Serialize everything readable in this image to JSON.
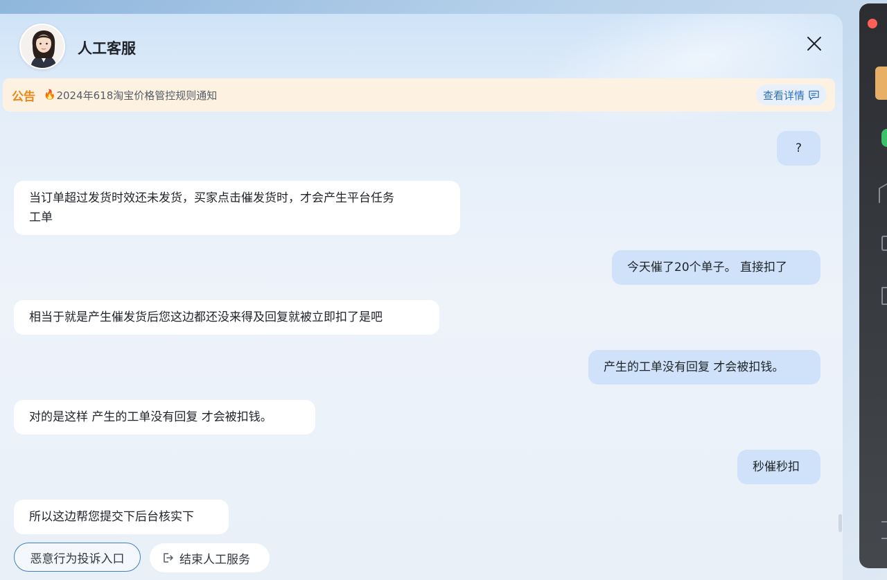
{
  "header": {
    "title": "人工客服"
  },
  "notice": {
    "label": "公告",
    "fire_icon": "🔥",
    "text": "2024年618淘宝价格管控规则通知",
    "detail_label": "查看详情"
  },
  "messages": [
    {
      "role": "user",
      "text": "?"
    },
    {
      "role": "agent",
      "line1": "当订单超过发货时效还未发货，买家点击催发货时，才会产生平台任务",
      "line2": "工单"
    },
    {
      "role": "user",
      "text": "今天催了20个单子。 直接扣了"
    },
    {
      "role": "agent",
      "text": "相当于就是产生催发货后您这边都还没来得及回复就被立即扣了是吧"
    },
    {
      "role": "user",
      "text": "产生的工单没有回复 才会被扣钱。"
    },
    {
      "role": "agent",
      "text": "对的是这样 产生的工单没有回复 才会被扣钱。"
    },
    {
      "role": "user",
      "text": "秒催秒扣"
    },
    {
      "role": "agent",
      "text": "所以这边帮您提交下后台核实下"
    }
  ],
  "quick_actions": {
    "complaint": "恶意行为投诉入口",
    "end_service": "结束人工服务"
  },
  "colors": {
    "accent": "#3d7fc4",
    "notice_label": "#e8881c",
    "user_bubble": "#cfe2f9",
    "agent_bubble": "#ffffff",
    "close_dot": "#ff5f57"
  }
}
